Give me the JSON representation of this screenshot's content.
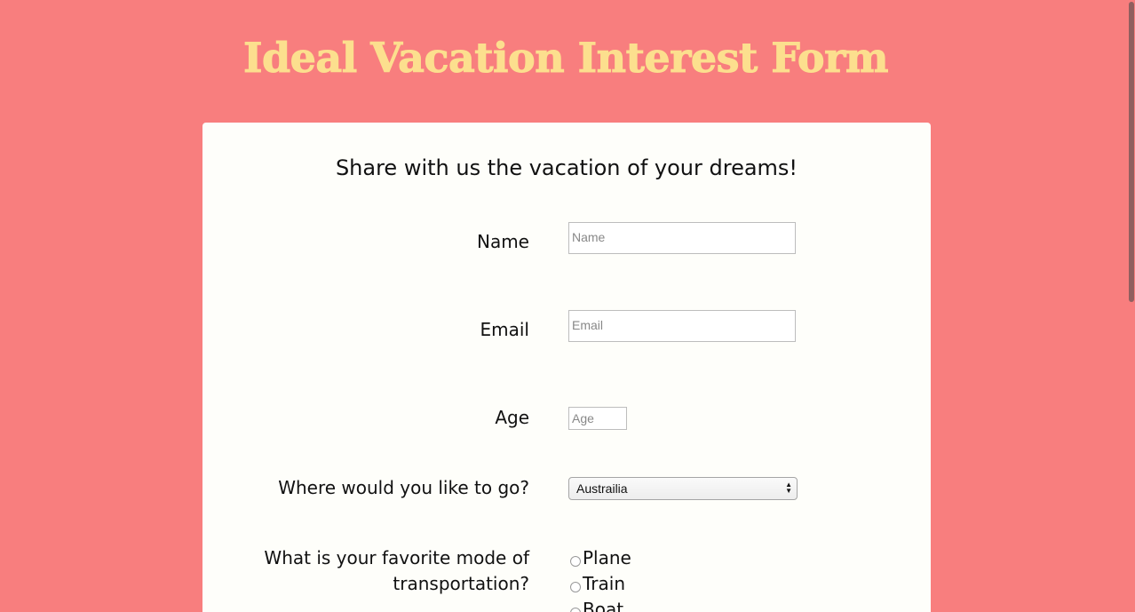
{
  "page": {
    "title": "Ideal Vacation Interest Form",
    "background_color": "#F87E7E",
    "title_color": "#FCDF8E",
    "card_color": "#FEFEFA"
  },
  "form": {
    "heading": "Share with us the vacation of your dreams!",
    "name": {
      "label": "Name",
      "placeholder": "Name",
      "value": ""
    },
    "email": {
      "label": "Email",
      "placeholder": "Email",
      "value": ""
    },
    "age": {
      "label": "Age",
      "placeholder": "Age",
      "value": ""
    },
    "destination": {
      "label": "Where would you like to go?",
      "selected": "Austrailia"
    },
    "transport": {
      "label_line1": "What is your favorite mode of",
      "label_line2": "transportation?",
      "options": [
        {
          "label": "Plane",
          "checked": false
        },
        {
          "label": "Train",
          "checked": false
        },
        {
          "label": "Boat",
          "checked": false
        }
      ]
    }
  }
}
